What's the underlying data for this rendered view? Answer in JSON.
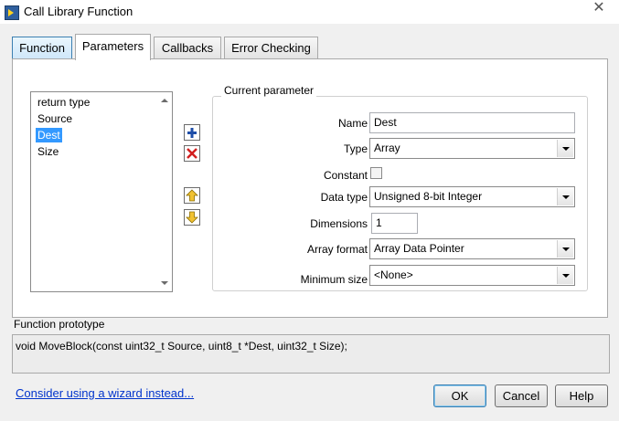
{
  "window": {
    "title": "Call Library Function",
    "close_glyph": "✕"
  },
  "tabs": [
    {
      "label": "Function"
    },
    {
      "label": "Parameters"
    },
    {
      "label": "Callbacks"
    },
    {
      "label": "Error Checking"
    }
  ],
  "parameter_list": {
    "items": [
      "return type",
      "Source",
      "Dest",
      "Size"
    ],
    "selected": "Dest"
  },
  "side_buttons": [
    {
      "name": "add-parameter",
      "icon": "plus-icon",
      "color": "#1f4ea8"
    },
    {
      "name": "delete-parameter",
      "icon": "x-icon",
      "color": "#d21f1f"
    },
    {
      "name": "move-up",
      "icon": "arrow-up-icon",
      "color": "#e3b21b"
    },
    {
      "name": "move-down",
      "icon": "arrow-down-icon",
      "color": "#e3b21b"
    }
  ],
  "current_parameter": {
    "legend": "Current parameter",
    "name_label": "Name",
    "name_value": "Dest",
    "type_label": "Type",
    "type_value": "Array",
    "constant_label": "Constant",
    "constant_checked": false,
    "data_type_label": "Data type",
    "data_type_value": "Unsigned 8-bit Integer",
    "dimensions_label": "Dimensions",
    "dimensions_value": "1",
    "array_format_label": "Array format",
    "array_format_value": "Array Data Pointer",
    "minimum_size_label": "Minimum size",
    "minimum_size_value": "<None>"
  },
  "prototype": {
    "label": "Function prototype",
    "text": "void  MoveBlock(const uint32_t Source, uint8_t *Dest, uint32_t Size);"
  },
  "footer": {
    "wizard_link": "Consider using a wizard instead...",
    "ok": "OK",
    "cancel": "Cancel",
    "help": "Help"
  }
}
